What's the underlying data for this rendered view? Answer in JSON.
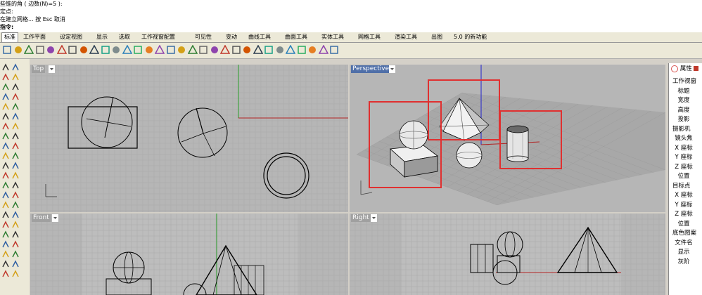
{
  "command_history": {
    "line1": "些锥的角 ( 边数(N)=5 ):",
    "line2": "定点:",
    "line3": "在建立网格... 按 Esc 取消",
    "prompt": "指令:"
  },
  "tabs": [
    "标准",
    "工作平面",
    "设定视图",
    "显示",
    "选取",
    "工作视窗配置",
    "可见性",
    "变动",
    "曲线工具",
    "曲面工具",
    "实体工具",
    "网格工具",
    "渲染工具",
    "出图",
    "5.0 的新功能"
  ],
  "active_tab_index": 0,
  "toolbar_icons": [
    "new-file-icon",
    "open-file-icon",
    "save-icon",
    "print-icon",
    "import-icon",
    "cut-icon",
    "copy-icon",
    "paste-icon",
    "undo-icon",
    "pan-icon",
    "rotate-view-icon",
    "zoom-window-icon",
    "zoom-extents-icon",
    "zoom-selected-icon",
    "zoom-icon",
    "undo-view-icon",
    "four-viewports-icon",
    "car-icon",
    "osnap-icon",
    "point-icon",
    "light-icon",
    "lock-icon",
    "paint-icon",
    "ring-icon",
    "render-sphere-icon",
    "material-sphere-icon",
    "environment-icon",
    "magic-icon",
    "gear-icon",
    "layer-icon",
    "help-icon"
  ],
  "viewports": {
    "top": {
      "label": "Top"
    },
    "perspective": {
      "label": "Perspective"
    },
    "front": {
      "label": "Front"
    },
    "right": {
      "label": "Right"
    }
  },
  "properties_panel": {
    "tab_label": "属性",
    "section_viewport": "工作视窗",
    "fields_viewport": [
      "标题",
      "宽度",
      "高度",
      "投影"
    ],
    "section_camera": "摄影机",
    "fields_camera": [
      "镜头焦",
      "X 座标",
      "Y 座标",
      "Z 座标",
      "位置"
    ],
    "section_target": "目标点",
    "fields_target": [
      "X 座标",
      "Y 座标",
      "Z 座标",
      "位置"
    ],
    "section_wallpaper": "底色图案",
    "fields_wallpaper": [
      "文件名",
      "显示",
      "灰阶"
    ]
  },
  "colors": {
    "viewport_bg": "#b6b6b6",
    "grid_line": "#a9a9a9",
    "axis_x": "#b22222",
    "axis_y": "#2a9d2a",
    "axis_z": "#2222cc",
    "highlight_box": "#e03030",
    "active_label": "#4f6fa8"
  }
}
